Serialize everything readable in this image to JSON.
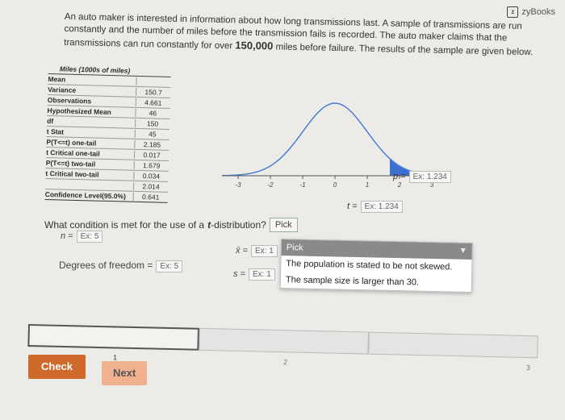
{
  "brand": "zyBooks",
  "problem": {
    "text_before": "An auto maker is interested in information about how long transmissions last. A sample of transmissions are run constantly and the number of miles before the transmission fails is recorded. The auto maker claims that the transmissions can run constantly for over ",
    "bold": "150,000",
    "text_after": " miles before failure. The results of the sample are given below."
  },
  "stats": {
    "header": "Miles (1000s of miles)",
    "rows": [
      {
        "label": "Mean",
        "value": ""
      },
      {
        "label": "Variance",
        "value": "150.7"
      },
      {
        "label": "Observations",
        "value": "4.661"
      },
      {
        "label": "Hypothesized Mean",
        "value": "46"
      },
      {
        "label": "df",
        "value": "150"
      },
      {
        "label": "t Stat",
        "value": "45"
      },
      {
        "label": "P(T<=t) one-tail",
        "value": "2.185"
      },
      {
        "label": "t Critical one-tail",
        "value": "0.017"
      },
      {
        "label": "P(T<=t) two-tail",
        "value": "1.679"
      },
      {
        "label": "t Critical two-tail",
        "value": "0.034"
      },
      {
        "label": "",
        "value": "2.014"
      },
      {
        "label": "Confidence Level(95.0%)",
        "value": "0.641"
      }
    ]
  },
  "curve": {
    "ticks": [
      "-3",
      "-2",
      "-1",
      "0",
      "1",
      "2",
      "3"
    ],
    "shade_color": "#3b6fd0",
    "line_color": "#4a7fd6"
  },
  "p_label": "p =",
  "p_value": "Ex: 1.234",
  "t_label": "t =",
  "t_value": "Ex: 1.234",
  "question": {
    "pre": "What condition is met for the use of a",
    "t": "t",
    "post": "-distribution?",
    "select_value": "Pick"
  },
  "n_label": "n =",
  "n_value": "Ex: 5",
  "dof_label": "Degrees of freedom =",
  "dof_value": "Ex: 5",
  "xbar_label": "x̄ =",
  "xbar_value": "Ex: 1",
  "s_label": "s =",
  "s_value": "Ex: 1",
  "dropdown": {
    "selected": "Pick",
    "options": [
      "The population is stated to be not skewed.",
      "The sample size is larger than 30."
    ]
  },
  "progress": {
    "steps": [
      "1",
      "2",
      "3"
    ],
    "current": "1"
  },
  "buttons": {
    "check": "Check",
    "next": "Next"
  }
}
